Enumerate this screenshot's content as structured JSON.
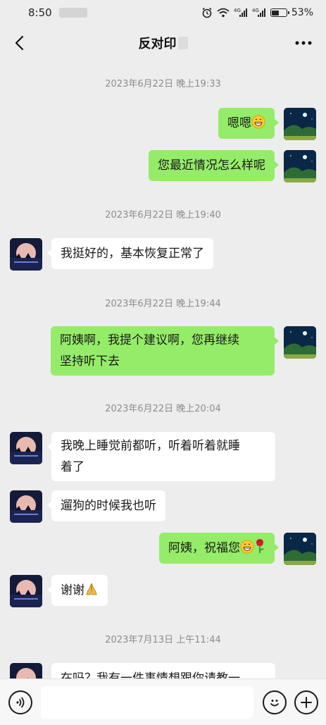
{
  "status_bar": {
    "time": "8:50",
    "battery": "53%",
    "signal_labels": [
      "4G",
      "4G"
    ]
  },
  "header": {
    "title": "反对印",
    "back_icon": "chevron-left-icon",
    "more_icon": "more-dots-icon"
  },
  "colors": {
    "background": "#ededed",
    "sent_bubble": "#95ec69",
    "received_bubble": "#ffffff",
    "timestamp": "#8c8c8c"
  },
  "chat": {
    "timestamps": [
      "2023年6月22日 晚上19:33",
      "2023年6月22日 晚上19:40",
      "2023年6月22日 晚上19:44",
      "2023年6月22日 晚上20:04",
      "2023年7月13日 上午11:44"
    ],
    "messages": [
      {
        "side": "sent",
        "text": "嗯嗯",
        "emoji": "grin-emoji"
      },
      {
        "side": "sent",
        "text": "您最近情况怎么样呢"
      },
      {
        "side": "received",
        "text": "我挺好的，基本恢复正常了"
      },
      {
        "side": "sent",
        "line1": "阿姨啊，我提个建议啊，您再继续",
        "line2": "坚持听下去"
      },
      {
        "side": "received",
        "line1": "我晚上睡觉前都听，听着听着就睡",
        "line2": "着了"
      },
      {
        "side": "received",
        "text": "遛狗的时候我也听"
      },
      {
        "side": "sent",
        "text": "阿姨，祝福您",
        "emoji": "grin-emoji",
        "emoji2": "rose-emoji"
      },
      {
        "side": "received",
        "text": "谢谢",
        "emoji": "folded-hands-emoji"
      },
      {
        "side": "received",
        "text": "在吗？我有一件事情想跟你请教一"
      }
    ]
  },
  "input_bar": {
    "voice_icon": "voice-icon",
    "emoji_icon": "smiley-icon",
    "plus_icon": "plus-icon",
    "placeholder": ""
  }
}
